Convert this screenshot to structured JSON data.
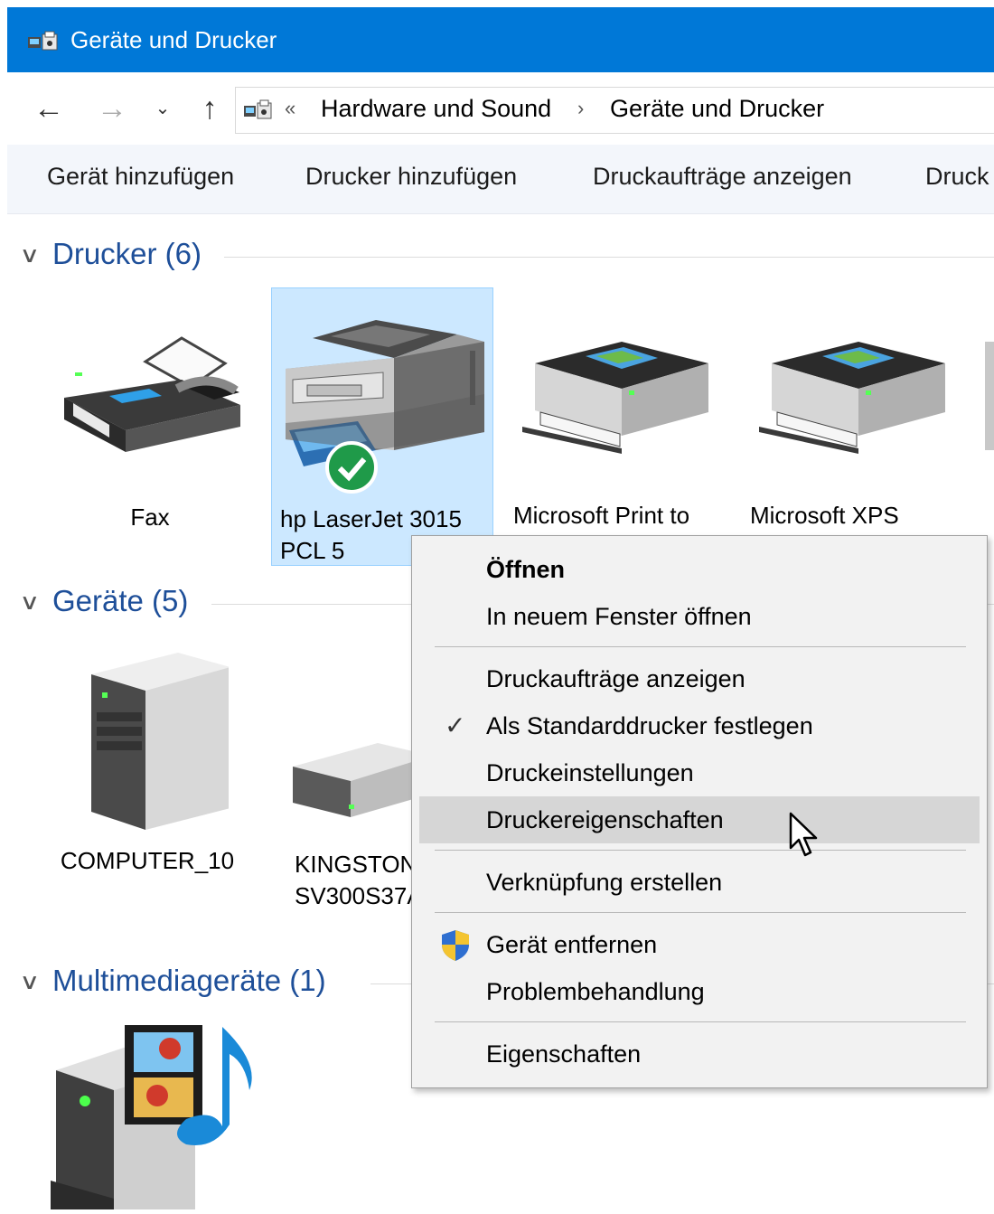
{
  "window": {
    "title": "Geräte und Drucker",
    "title_icon": "devices-printers-icon"
  },
  "nav": {
    "back_icon": "back-arrow-icon",
    "forward_icon": "forward-arrow-icon",
    "recent_icon": "chevron-down-icon",
    "up_icon": "up-arrow-icon"
  },
  "address": {
    "overflow": "«",
    "segments": [
      "Hardware und Sound",
      "Geräte und Drucker"
    ],
    "separator": "›"
  },
  "toolbar": {
    "buttons": [
      "Gerät hinzufügen",
      "Drucker hinzufügen",
      "Druckaufträge anzeigen",
      "Druck"
    ]
  },
  "groups": {
    "printers": {
      "title": "Drucker (6)",
      "items": [
        {
          "label": "Fax",
          "icon": "fax-icon"
        },
        {
          "label_line1": "hp LaserJet 3015",
          "label_line2": "PCL 5",
          "icon": "laser-printer-icon",
          "default": true
        },
        {
          "label": "Microsoft Print to",
          "icon": "printer-icon"
        },
        {
          "label": "Microsoft XPS",
          "icon": "printer-icon"
        }
      ]
    },
    "devices": {
      "title": "Geräte (5)",
      "items": [
        {
          "label": "COMPUTER_10",
          "icon": "computer-tower-icon"
        },
        {
          "label_line1": "KINGSTON",
          "label_line2": "SV300S37A",
          "icon": "hard-drive-icon"
        }
      ]
    },
    "multimedia": {
      "title": "Multimediageräte (1)",
      "items": [
        {
          "icon": "media-server-icon"
        }
      ]
    }
  },
  "context_menu": {
    "open": "Öffnen",
    "open_new_window": "In neuem Fenster öffnen",
    "show_jobs": "Druckaufträge anzeigen",
    "set_default": "Als Standarddrucker festlegen",
    "print_settings": "Druckeinstellungen",
    "printer_properties": "Druckereigenschaften",
    "create_shortcut": "Verknüpfung erstellen",
    "remove_device": "Gerät entfernen",
    "troubleshoot": "Problembehandlung",
    "properties": "Eigenschaften",
    "checked_item": "set_default",
    "hovered_item": "printer_properties"
  },
  "colors": {
    "titlebar": "#0078d7",
    "group_title": "#1e4f99",
    "selection": "#cce8ff",
    "menu_bg": "#f2f2f2",
    "menu_hover": "#d6d6d6"
  }
}
